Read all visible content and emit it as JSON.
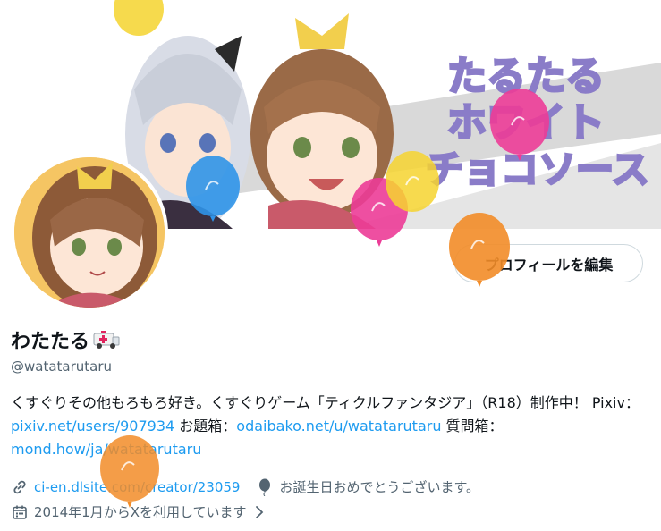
{
  "profile": {
    "display_name": "わたたる",
    "display_name_emoji": "ambulance-emoji",
    "handle": "@watatarutaru",
    "edit_button_label": "プロフィールを編集",
    "banner_title_lines": [
      "たるたる",
      "ホワイト",
      "チョコソース"
    ],
    "bio": {
      "text1": "くすぐりその他もろもろ好き。くすぐりゲーム「ティクルファンタジア」（R18）制作中！ Pixiv：",
      "link1": "pixiv.net/users/907934",
      "text2": " お題箱：",
      "link2": "odaibako.net/u/watatarutaru",
      "text3": " 質問箱：",
      "link3": "mond.how/ja/watatarutaru"
    },
    "website": "ci-en.dlsite.com/creator/23059",
    "birthday_text": "お誕生日おめでとうございます。",
    "joined_text": "2014年1月からXを利用しています"
  },
  "icons": {
    "link": "link-icon",
    "balloon": "balloon-icon",
    "calendar": "calendar-icon",
    "chevron": "chevron-right-icon"
  },
  "colors": {
    "link_blue": "#1d9bf0",
    "secondary_text": "#536471",
    "title_purple": "#8a7cc8"
  }
}
